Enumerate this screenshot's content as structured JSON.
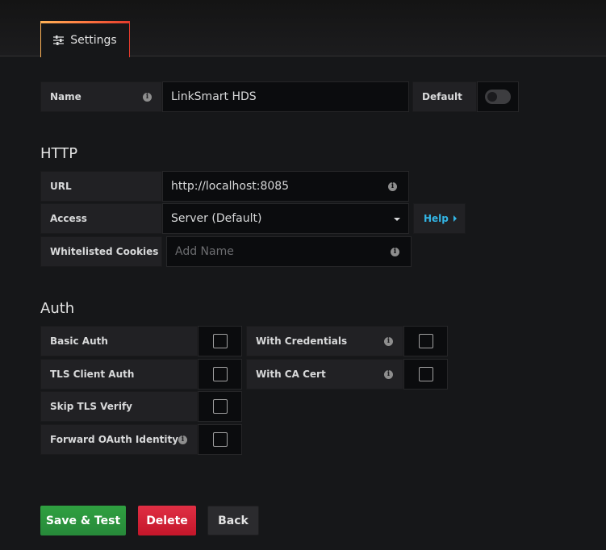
{
  "tabs": [
    {
      "label": "Settings",
      "icon": "sliders-icon",
      "active": true
    }
  ],
  "name_row": {
    "label": "Name",
    "value": "LinkSmart HDS",
    "default_label": "Default",
    "default_on": false
  },
  "http": {
    "title": "HTTP",
    "url_label": "URL",
    "url_value": "http://localhost:8085",
    "access_label": "Access",
    "access_value": "Server (Default)",
    "help_label": "Help",
    "cookies_label": "Whitelisted Cookies",
    "cookies_placeholder": "Add Name"
  },
  "auth": {
    "title": "Auth",
    "basic_auth": {
      "label": "Basic Auth",
      "checked": false
    },
    "with_credentials": {
      "label": "With Credentials",
      "checked": false
    },
    "tls_client_auth": {
      "label": "TLS Client Auth",
      "checked": false
    },
    "with_ca_cert": {
      "label": "With CA Cert",
      "checked": false
    },
    "skip_tls_verify": {
      "label": "Skip TLS Verify",
      "checked": false
    },
    "forward_oauth": {
      "label": "Forward OAuth Identity",
      "checked": false
    }
  },
  "buttons": {
    "save": "Save & Test",
    "delete": "Delete",
    "back": "Back"
  },
  "colors": {
    "accent_blue": "#33b5e5",
    "save_green": "#299c46",
    "delete_red": "#e02f44"
  }
}
